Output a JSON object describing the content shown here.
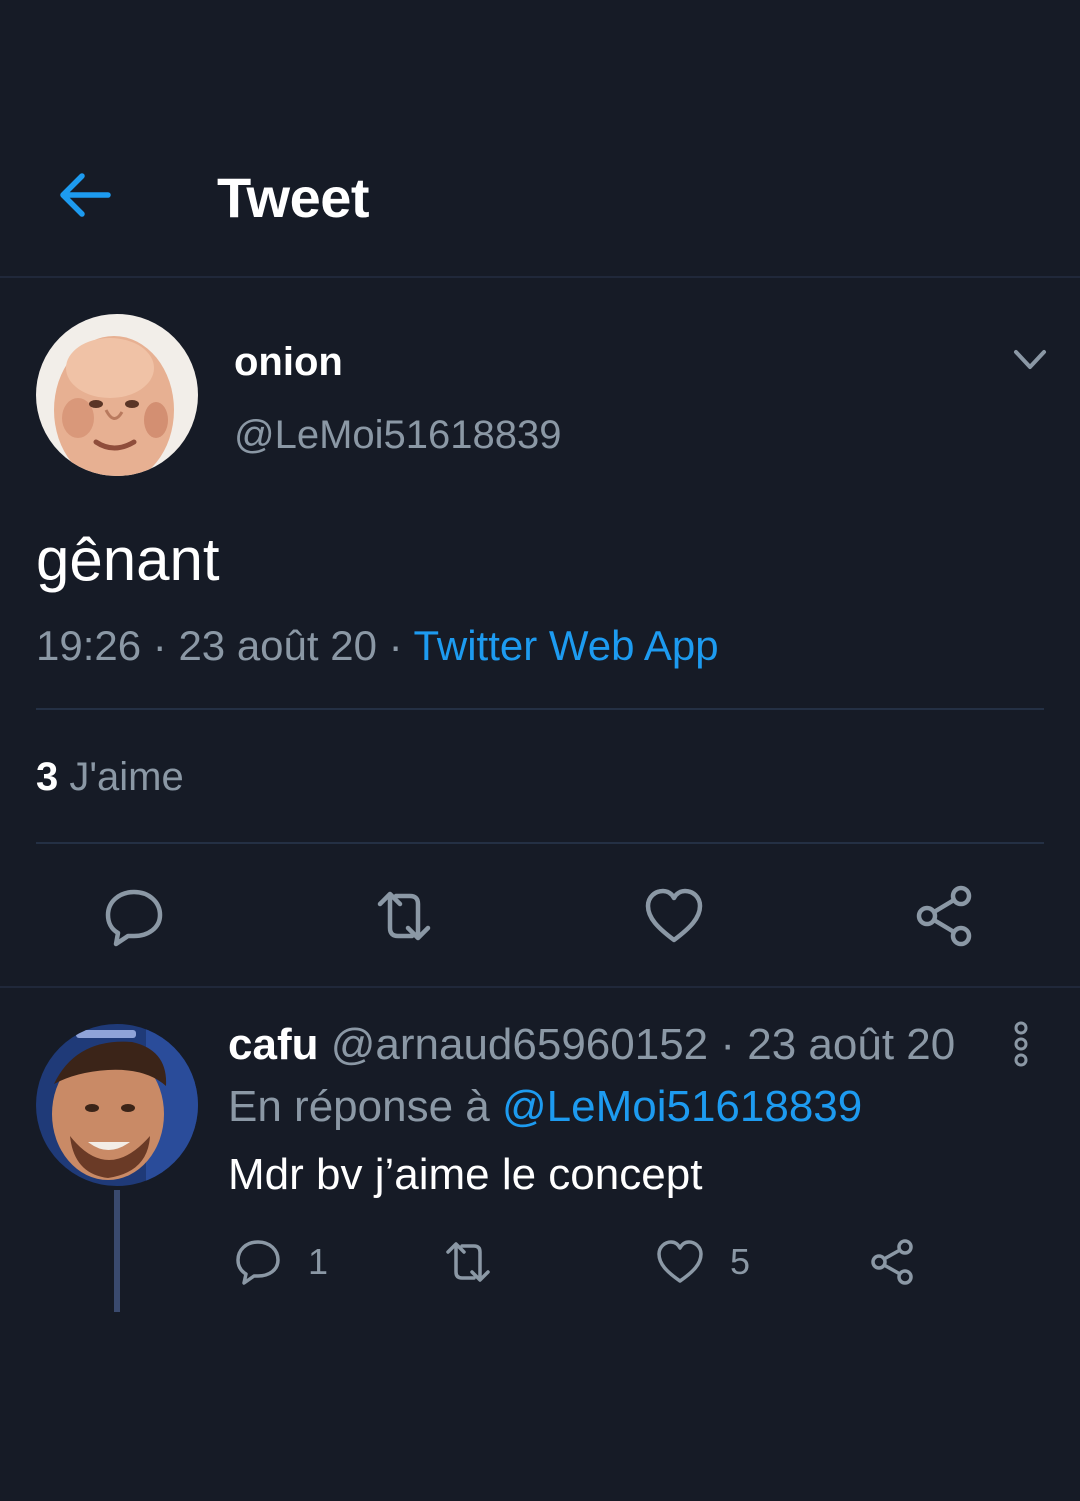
{
  "header": {
    "title": "Tweet",
    "back_icon": "arrow-left-icon"
  },
  "colors": {
    "background": "#161b26",
    "accent": "#1d9bf0",
    "secondary_text": "#8b98a5",
    "divider": "#243044"
  },
  "tweet": {
    "display_name": "onion",
    "handle": "@LeMoi51618839",
    "text": "gênant",
    "time": "19:26",
    "separator": " · ",
    "date": "23 août 20",
    "source": "Twitter Web App",
    "likes_count": "3",
    "likes_label": " J'aime",
    "actions": [
      "reply-icon",
      "retweet-icon",
      "heart-icon",
      "share-icon"
    ]
  },
  "reply": {
    "display_name": "cafu",
    "handle": "@arnaud65960152",
    "separator": " · ",
    "date": "23 août 20",
    "reply_prefix": "En réponse à ",
    "reply_mention": "@LeMoi51618839",
    "text": "Mdr bv j’aime le concept",
    "reply_count": "1",
    "like_count": "5"
  }
}
